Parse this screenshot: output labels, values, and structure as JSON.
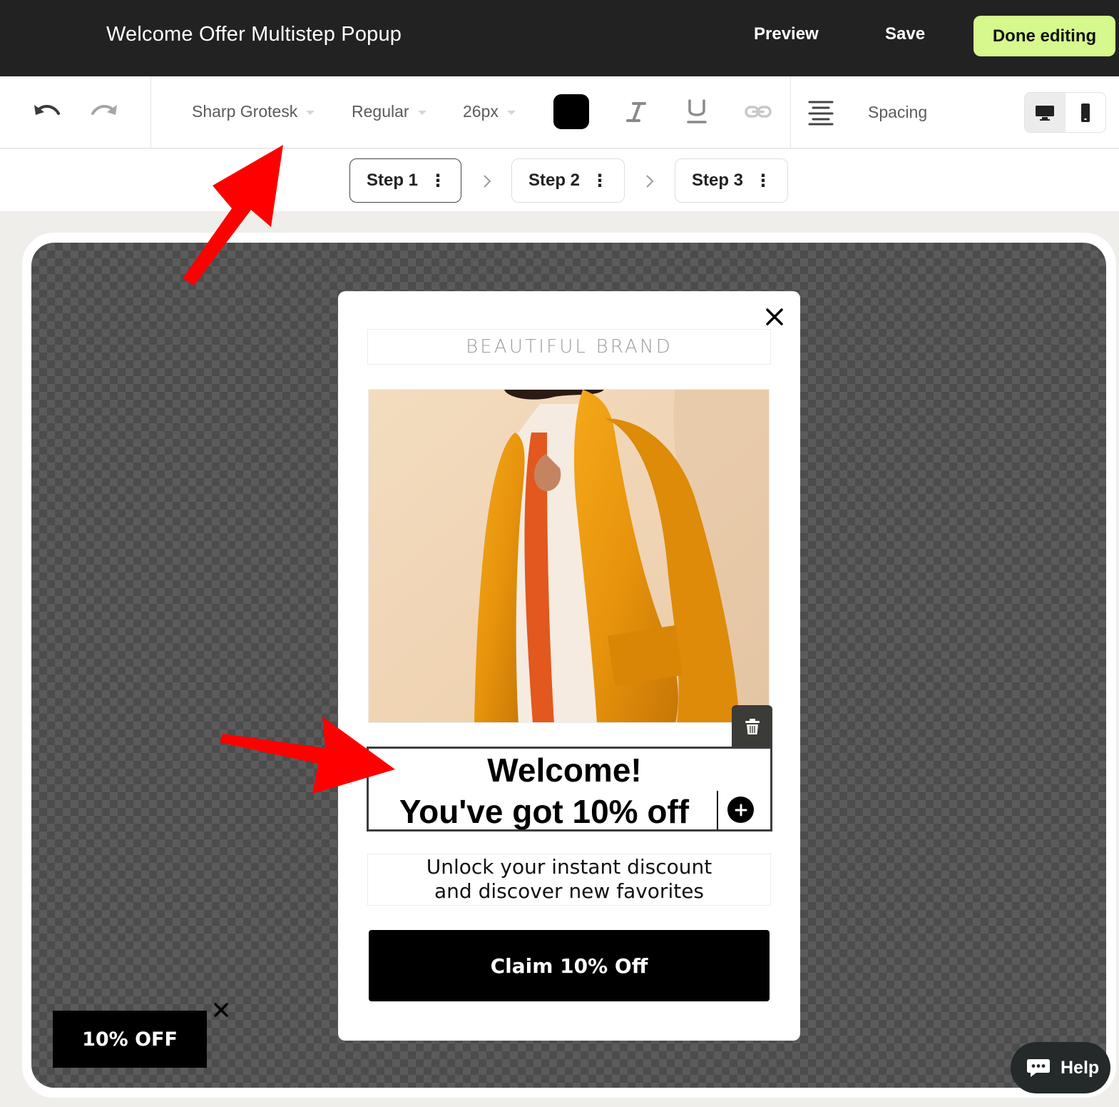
{
  "app": {
    "title": "Welcome Offer Multistep Popup",
    "preview_label": "Preview",
    "save_label": "Save",
    "done_label": "Done editing",
    "accent_color": "#d6f88d"
  },
  "toolbar": {
    "font_family": "Sharp Grotesk",
    "font_weight": "Regular",
    "font_size": "26px",
    "text_color": "#000000",
    "spacing_label": "Spacing",
    "icons": [
      "undo-icon",
      "redo-icon",
      "italic-icon",
      "underline-icon",
      "link-icon",
      "align-center-icon",
      "desktop-icon",
      "mobile-icon"
    ],
    "active_device": "desktop"
  },
  "steps": [
    {
      "label": "Step 1",
      "menu": "⋮",
      "active": true
    },
    {
      "label": "Step 2",
      "menu": "⋮",
      "active": false
    },
    {
      "label": "Step 3",
      "menu": "⋮",
      "active": false
    }
  ],
  "popup": {
    "brand": "BEAUTIFUL BRAND",
    "headline_line1": "Welcome!",
    "headline_line2": "You've got 10% off",
    "subtext_line1": "Unlock your instant discount",
    "subtext_line2": "and discover new favorites",
    "cta_label": "Claim 10% Off"
  },
  "teaser": {
    "label": "10% OFF"
  },
  "help": {
    "label": "Help"
  },
  "annotations": {
    "arrow_color": "#ff0000"
  }
}
